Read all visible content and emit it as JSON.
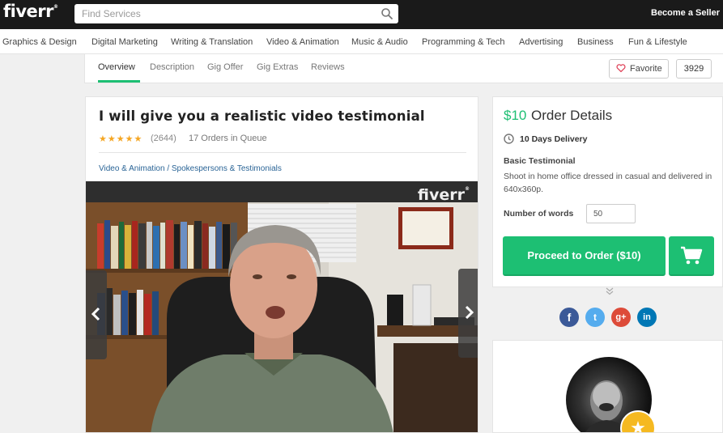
{
  "header": {
    "logo": "fiverr",
    "logo_mark": "®",
    "search_placeholder": "Find Services",
    "become_seller": "Become a Seller"
  },
  "categories": [
    "Graphics & Design",
    "Digital Marketing",
    "Writing & Translation",
    "Video & Animation",
    "Music & Audio",
    "Programming & Tech",
    "Advertising",
    "Business",
    "Fun & Lifestyle"
  ],
  "tabs": [
    "Overview",
    "Description",
    "Gig Offer",
    "Gig Extras",
    "Reviews"
  ],
  "active_tab": "Overview",
  "favorite": {
    "label": "Favorite",
    "count": "3929"
  },
  "gig": {
    "title": "I will give you a realistic video testimonial",
    "stars": "★★★★★",
    "rating_value": 5,
    "reviews_count": "(2644)",
    "orders_in_queue": "17 Orders in Queue",
    "breadcrumb": [
      "Video & Animation",
      "Spokespersons & Testimonials"
    ],
    "breadcrumb_separator": " / ",
    "video_watermark": "fiverr",
    "video_watermark_mark": "®"
  },
  "order": {
    "price": "$10",
    "title": "Order Details",
    "delivery": "10 Days Delivery",
    "package_name": "Basic Testimonial",
    "package_description": "Shoot in home office dressed in casual and delivered in 640x360p.",
    "words_label": "Number of words",
    "words_value": "50",
    "proceed_label": "Proceed to Order ($10)"
  },
  "social": {
    "facebook": "f",
    "twitter": "t",
    "google_plus": "g+",
    "linkedin": "in"
  },
  "colors": {
    "brand_green": "#1dbf73",
    "topbar": "#1a1a1a",
    "link": "#2a6496",
    "star": "#f5a623"
  },
  "icons": [
    "search-icon",
    "heart-icon",
    "clock-icon",
    "cart-icon",
    "chevron-left-icon",
    "chevron-right-icon",
    "double-chevron-down-icon",
    "star-icon"
  ]
}
